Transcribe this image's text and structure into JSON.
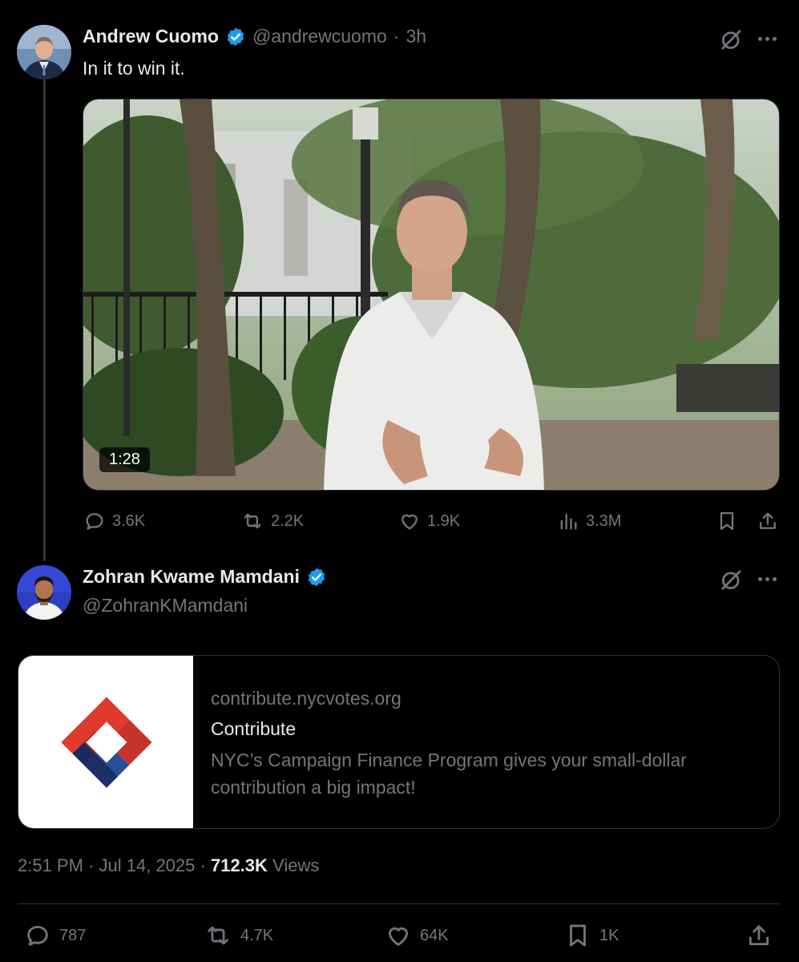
{
  "tweet1": {
    "display_name": "Andrew Cuomo",
    "handle": "@andrewcuomo",
    "separator": "·",
    "time": "3h",
    "text": "In it to win it.",
    "video_duration": "1:28",
    "stats": {
      "replies": "3.6K",
      "retweets": "2.2K",
      "likes": "1.9K",
      "views": "3.3M"
    }
  },
  "tweet2": {
    "display_name": "Zohran Kwame Mamdani",
    "handle": "@ZohranKMamdani",
    "card": {
      "domain": "contribute.nycvotes.org",
      "title": "Contribute",
      "description": "NYC’s Campaign Finance Program gives your small-dollar contribution a big impact!"
    },
    "meta": {
      "time": "2:51 PM",
      "sep1": "·",
      "date": "Jul 14, 2025",
      "sep2": "·",
      "views_count": "712.3K",
      "views_label": "Views"
    },
    "stats": {
      "replies": "787",
      "retweets": "4.7K",
      "likes": "64K",
      "bookmarks": "1K"
    }
  },
  "colors": {
    "background": "#000000",
    "text": "#e7e9ea",
    "muted": "#71767b",
    "verified": "#1d9bf0",
    "border": "#2f3336"
  },
  "icons": {
    "verified": "verified-badge-icon",
    "grok": "grok-icon",
    "more": "more-icon",
    "reply": "reply-icon",
    "retweet": "retweet-icon",
    "like": "heart-icon",
    "views": "views-icon",
    "bookmark": "bookmark-icon",
    "share": "share-icon"
  }
}
